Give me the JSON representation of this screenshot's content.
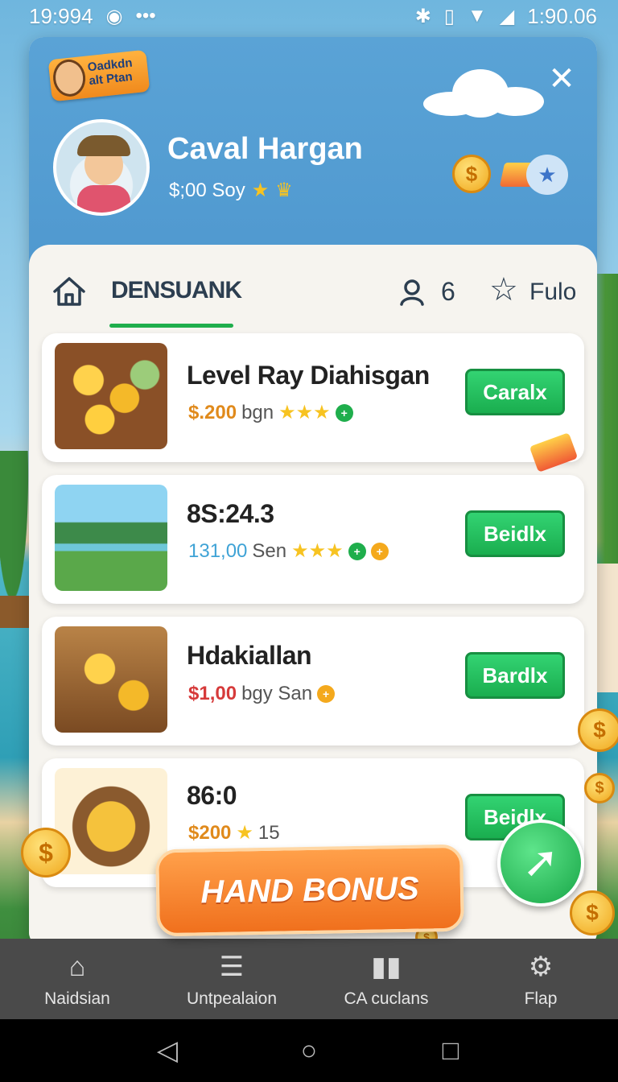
{
  "status_bar": {
    "time_left": "19:994",
    "time_right": "1:90.06",
    "icons": [
      "notification-icon",
      "more-dots-icon",
      "bluetooth-icon",
      "vibrate-icon",
      "wifi-icon",
      "signal-icon"
    ]
  },
  "header": {
    "badge_text": "Oadkdn alt Ptan",
    "player_name": "Caval Hargan",
    "player_sub": "$;00 Soy",
    "close_label": "✕"
  },
  "tabs": {
    "active_label": "DENSUANK",
    "user_count": "6",
    "favorites_label": "Fulo"
  },
  "offers": [
    {
      "title": "Level Ray Diahisgan",
      "price": "$.200",
      "unit": "bgn",
      "stars": "★★★",
      "button": "Caralx",
      "thumb": "coins-money-icon"
    },
    {
      "title": "8S:24.3",
      "price": "131,00",
      "unit": "Sen",
      "stars": "★★★",
      "button": "Beidlx",
      "thumb": "island-path-icon"
    },
    {
      "title": "Hdakiallan",
      "price": "$1,00",
      "unit": "bgy San",
      "stars": "",
      "button": "Bardlx",
      "thumb": "treasure-box-icon"
    },
    {
      "title": "86:0",
      "price": "$200",
      "unit": "15",
      "stars": "★",
      "button": "Beidlx",
      "thumb": "coin-pot-icon"
    }
  ],
  "bonus_button": "HAND BONUS",
  "bottom_nav": [
    {
      "label": "Naidsian",
      "icon": "home-icon"
    },
    {
      "label": "Untpealaion",
      "icon": "list-icon"
    },
    {
      "label": "CA cuclans",
      "icon": "stats-icon"
    },
    {
      "label": "Flap",
      "icon": "gear-icon"
    }
  ],
  "system_nav": {
    "back": "◁",
    "home": "○",
    "recents": "□"
  },
  "colors": {
    "accent_green": "#1fae4c",
    "header_blue": "#5aa3d6",
    "bonus_orange": "#f0701d",
    "nav_dark": "#4a4a4a"
  }
}
